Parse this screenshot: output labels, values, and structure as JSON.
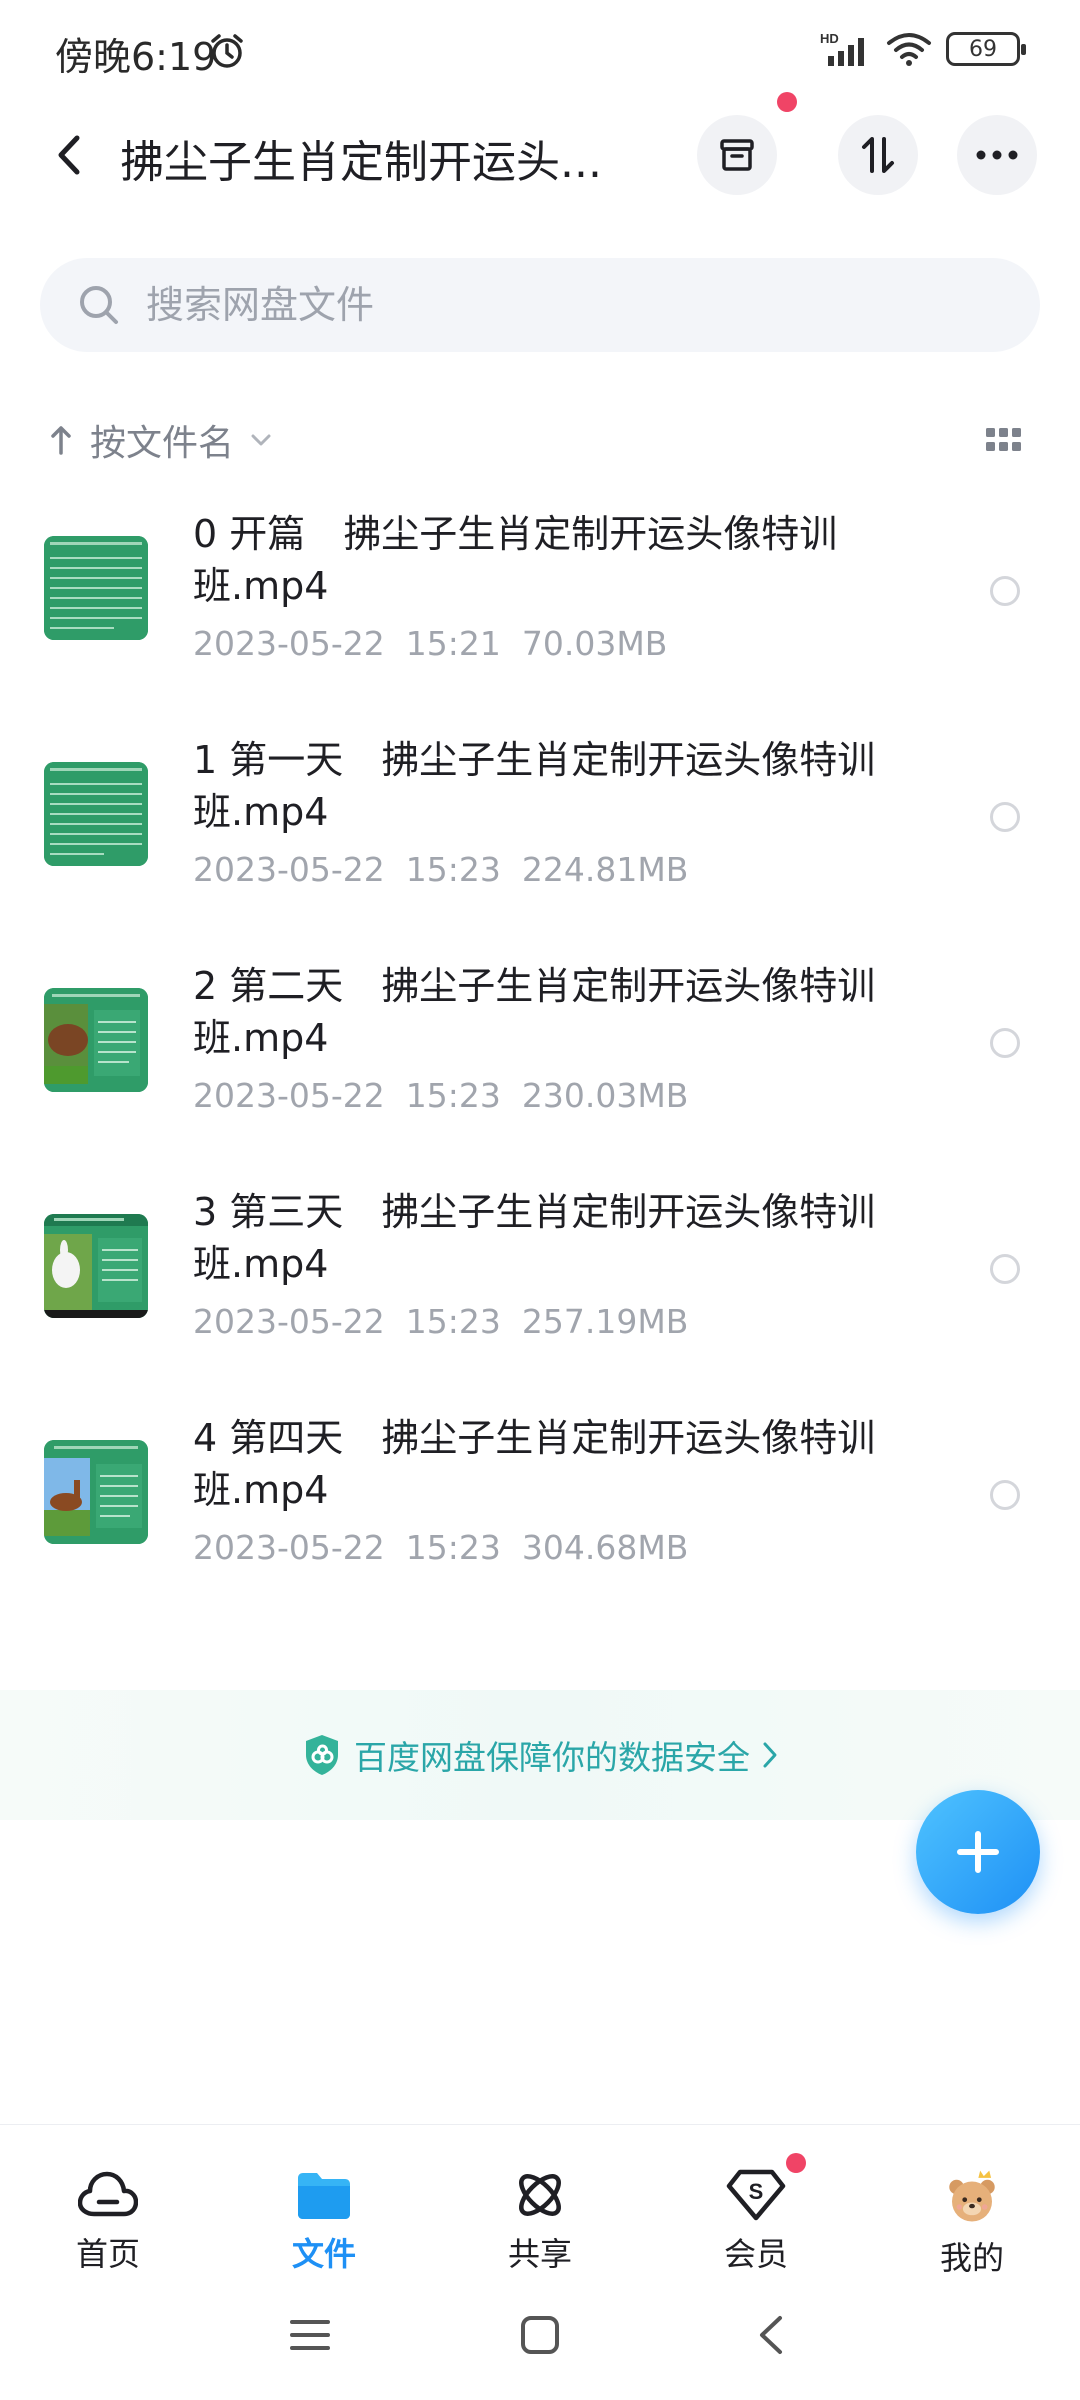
{
  "status_bar": {
    "time": "傍晚6:19",
    "network": "HD",
    "battery": "69"
  },
  "header": {
    "title": "拂尘子生肖定制开运头..."
  },
  "search": {
    "placeholder": "搜索网盘文件",
    "value": ""
  },
  "sort": {
    "label": "按文件名"
  },
  "files": [
    {
      "name": "0 开篇　拂尘子生肖定制开运头像特训班.mp4",
      "date": "2023-05-22",
      "time": "15:21",
      "size": "70.03MB"
    },
    {
      "name": "1 第一天　拂尘子生肖定制开运头像特训班.mp4",
      "date": "2023-05-22",
      "time": "15:23",
      "size": "224.81MB"
    },
    {
      "name": "2 第二天　拂尘子生肖定制开运头像特训班.mp4",
      "date": "2023-05-22",
      "time": "15:23",
      "size": "230.03MB"
    },
    {
      "name": "3 第三天　拂尘子生肖定制开运头像特训班.mp4",
      "date": "2023-05-22",
      "time": "15:23",
      "size": "257.19MB"
    },
    {
      "name": "4 第四天　拂尘子生肖定制开运头像特训班.mp4",
      "date": "2023-05-22",
      "time": "15:23",
      "size": "304.68MB"
    }
  ],
  "safety_banner": {
    "text": "百度网盘保障你的数据安全"
  },
  "bottom_nav": {
    "home": "首页",
    "files": "文件",
    "share": "共享",
    "vip": "会员",
    "mine": "我的"
  },
  "colors": {
    "accent": "#1e90f5",
    "badge": "#f04466",
    "safety": "#2aa6a8"
  }
}
